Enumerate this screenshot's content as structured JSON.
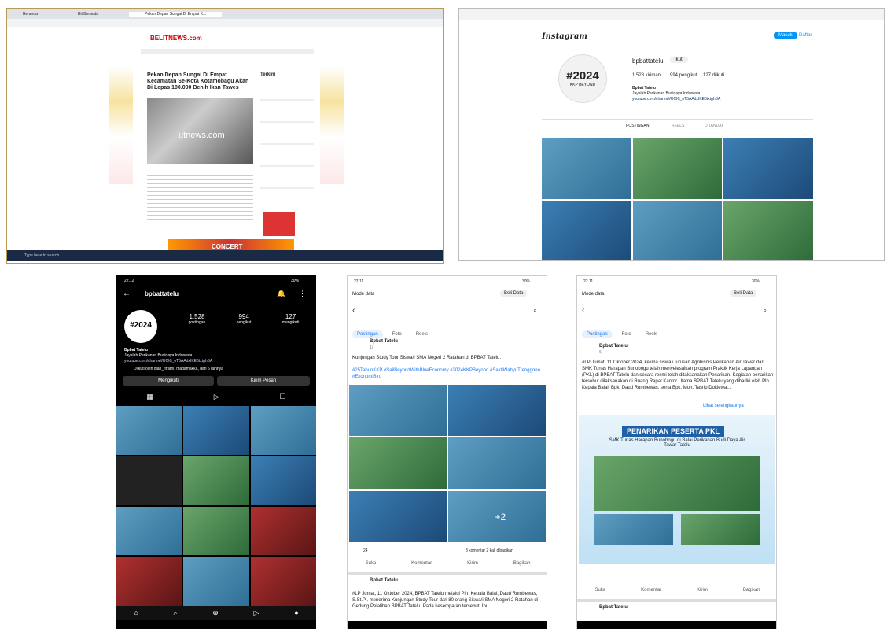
{
  "desktop": {
    "tabs": [
      "Beranda",
      "Bit Beranda",
      "Pekan Depan Sungai Di Empat K..."
    ],
    "site_logo": "BELITNEWS.com",
    "headline": "Pekan Depan Sungai Di Empat Kecamatan Se-Kota Kotamobagu Akan Di Lepas 100.000 Benih Ikan Tawes",
    "image_caption": "utnews.com",
    "sidebar_title": "Terkini",
    "taskbar_search": "Type here to search",
    "banner_text": "CONCERT"
  },
  "instagram_web": {
    "logo": "Instagram",
    "username": "bpbattatelu",
    "follow_label": "Ikuti",
    "stats": {
      "posts": "1.528 kiriman",
      "followers": "994 pengikut",
      "following": "127 diikuti"
    },
    "name": "Bpbat Tatelu",
    "bio": "Jayalah Perikanan Budidaya Indonesia",
    "link": "youtube.com/channel/UCKi_oT5AAdxIKE6txtghBA",
    "avatar_text": "#2024",
    "avatar_sub": "KKP BEYOND",
    "tabs": [
      "POSTINGAN",
      "REELS",
      "DITANDAI"
    ],
    "login_label": "Masuk",
    "signup_label": "Daftar"
  },
  "ig_mobile": {
    "status_time": "22.12",
    "status_right": "30%",
    "username": "bpbattatelu",
    "stats": [
      {
        "num": "1.528",
        "label": "postingan"
      },
      {
        "num": "994",
        "label": "pengikut"
      },
      {
        "num": "127",
        "label": "mengikuti"
      }
    ],
    "name": "Bpbat Tatelu",
    "bio": "Jayalah Perikanan Budidaya Indonesia",
    "link": "youtube.com/channel/UCKi_oT5AAdxIKE6txtghBA",
    "followed_by": "Diikuti oleh dian_fitriani, madamakka, dan 6 lainnya",
    "follow_btn": "Mengikuti",
    "message_btn": "Kirim Pesan"
  },
  "fb_mobile_1": {
    "status_time": "22.11",
    "status_right": "30%",
    "mode": "Mode data",
    "buy": "Beli Data",
    "tabs": [
      "Postingan",
      "Foto",
      "Reels"
    ],
    "page_name": "Bpbat Tatelu",
    "post_time": "1j",
    "post_text": "Kunjungan Study Tour Siswa/i SMA Negeri 2 Ratahan di BPBAT Tatelu.",
    "hashtags": "#25TahunKKP #SailBeyondWithBlueEconomy #2024KKPBeyond #SaktiWahyuTrenggono #EkonomiBiru",
    "plus_count": "+2",
    "reaction_count": "24",
    "comments": "3 komentar 2 kali dibagikan",
    "actions": [
      "Suka",
      "Komentar",
      "Kirim",
      "Bagikan"
    ],
    "post2_text": "#LP Jumat, 11 Oktober 2024, BPBAT Tatelu melalui Plh. Kepala Balai, Daud Rumbewas, S.St.Pi. menerima Kunjungan Study Tour dari 80 orang Siswa/i SMA Negeri 2 Ratahan di Gedung Pelatihan BPBAT Tatelu. Pada kesempatan tersebut, Ibu"
  },
  "fb_mobile_2": {
    "status_time": "22.11",
    "status_right": "30%",
    "mode": "Mode data",
    "buy": "Beli Data",
    "tabs": [
      "Postingan",
      "Foto",
      "Reels"
    ],
    "page_name": "Bpbat Tatelu",
    "post_time": "6j",
    "post_text": "#LP Jumat, 11 Oktober 2024, kelima siswa/i jurusan Agribisnis Perikanan Air Tawar dari SMK Tunas Harapan Bunobogu telah menyelesaikan program Praktik Kerja Lapangan (PKL) di BPBAT Tatelu dan secara resmi telah ditaksanakan Penarikan. Kegiatan penarikan tersebut dilaksanakan di Ruang Rapat Kantor Utama BPBAT Tatelu yang dihadiri oleh Plh. Kepala Balai, Bpk. Daud Rumbewas, serta Bpk. Moh. Tasrip Doklewa...",
    "see_more": "Lihat selengkapnya",
    "banner_title": "PENARIKAN PESERTA PKL",
    "banner_sub": "SMK Tunas Harapan Bunobogu di Balai Perikanan Budi Daya Air Tawar Tatelu",
    "actions": [
      "Suka",
      "Komentar",
      "Kirim",
      "Bagikan"
    ],
    "next_page_name": "Bpbat Tatelu"
  },
  "colors": {
    "fb_blue": "#1877f2",
    "ig_blue": "#0095f6",
    "panel_border": "#b89a58"
  }
}
